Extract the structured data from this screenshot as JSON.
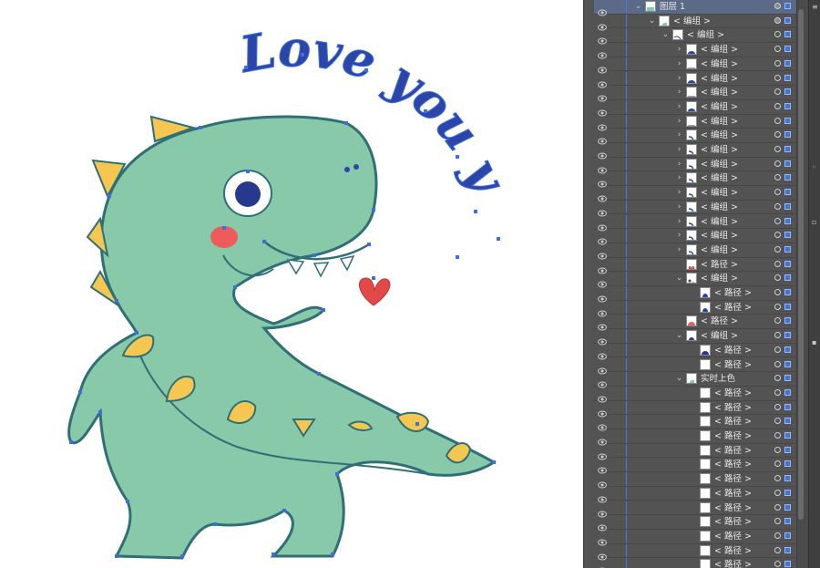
{
  "canvas": {
    "art_text": "Love you yo !!!"
  },
  "colors": {
    "dino_fill": "#88c9a9",
    "dino_stroke": "#2f6f78",
    "spike_yellow": "#f5c750",
    "text_blue": "#2b45a8",
    "cheek_red": "#ef5b5b",
    "heart_red": "#e24a4a",
    "eye_blue": "#27388f",
    "anchor_blue": "#3d6fe0",
    "panel_bg": "#535353",
    "panel_sel": "#5b6a86"
  },
  "layers_panel": {
    "rows": [
      {
        "label": "图层 1",
        "indent": 0,
        "expand": "open",
        "thumb": "layer",
        "selected": true,
        "target": "filled"
      },
      {
        "label": "< 编组 >",
        "indent": 1,
        "expand": "open",
        "thumb": "dino",
        "target": "filled"
      },
      {
        "label": "< 编组 >",
        "indent": 2,
        "expand": "open",
        "thumb": "text",
        "target": "ring"
      },
      {
        "label": "< 编组 >",
        "indent": 3,
        "expand": "closed",
        "thumb": "blob",
        "target": "ring"
      },
      {
        "label": "< 编组 >",
        "indent": 3,
        "expand": "closed",
        "thumb": "line",
        "target": "ring"
      },
      {
        "label": "< 编组 >",
        "indent": 3,
        "expand": "closed",
        "thumb": "blob",
        "target": "ring"
      },
      {
        "label": "< 编组 >",
        "indent": 3,
        "expand": "closed",
        "thumb": "line",
        "target": "ring"
      },
      {
        "label": "< 编组 >",
        "indent": 3,
        "expand": "closed",
        "thumb": "blob",
        "target": "ring"
      },
      {
        "label": "< 编组 >",
        "indent": 3,
        "expand": "closed",
        "thumb": "line",
        "target": "ring"
      },
      {
        "label": "< 编组 >",
        "indent": 3,
        "expand": "closed",
        "thumb": "glyph",
        "target": "ring"
      },
      {
        "label": "< 编组 >",
        "indent": 3,
        "expand": "closed",
        "thumb": "glyph",
        "target": "ring"
      },
      {
        "label": "< 编组 >",
        "indent": 3,
        "expand": "closed",
        "thumb": "glyph",
        "target": "ring"
      },
      {
        "label": "< 编组 >",
        "indent": 3,
        "expand": "closed",
        "thumb": "glyph",
        "target": "ring"
      },
      {
        "label": "< 编组 >",
        "indent": 3,
        "expand": "closed",
        "thumb": "glyph",
        "target": "ring"
      },
      {
        "label": "< 编组 >",
        "indent": 3,
        "expand": "closed",
        "thumb": "glyph",
        "target": "ring"
      },
      {
        "label": "< 编组 >",
        "indent": 3,
        "expand": "closed",
        "thumb": "glyph",
        "target": "ring"
      },
      {
        "label": "< 编组 >",
        "indent": 3,
        "expand": "closed",
        "thumb": "glyph",
        "target": "ring"
      },
      {
        "label": "< 编组 >",
        "indent": 3,
        "expand": "closed",
        "thumb": "glyph",
        "target": "ring"
      },
      {
        "label": "< 路径 >",
        "indent": 3,
        "expand": "none",
        "thumb": "heart",
        "target": "ring"
      },
      {
        "label": "< 编组 >",
        "indent": 3,
        "expand": "open",
        "thumb": "dots",
        "target": "ring"
      },
      {
        "label": "< 路径 >",
        "indent": 4,
        "expand": "none",
        "thumb": "oval",
        "target": "ring"
      },
      {
        "label": "< 路径 >",
        "indent": 4,
        "expand": "none",
        "thumb": "oval",
        "target": "ring"
      },
      {
        "label": "< 路径 >",
        "indent": 3,
        "expand": "none",
        "thumb": "cheek",
        "target": "ring"
      },
      {
        "label": "< 编组 >",
        "indent": 3,
        "expand": "open",
        "thumb": "eye",
        "target": "ring"
      },
      {
        "label": "< 路径 >",
        "indent": 4,
        "expand": "none",
        "thumb": "pupil",
        "target": "ring"
      },
      {
        "label": "< 路径 >",
        "indent": 4,
        "expand": "none",
        "thumb": "white",
        "target": "ring"
      },
      {
        "label": "实时上色",
        "indent": 3,
        "expand": "open",
        "thumb": "dino",
        "target": "ring"
      },
      {
        "label": "< 路径 >",
        "indent": 4,
        "expand": "none",
        "thumb": "white",
        "target": "ring"
      },
      {
        "label": "< 路径 >",
        "indent": 4,
        "expand": "none",
        "thumb": "white",
        "target": "ring"
      },
      {
        "label": "< 路径 >",
        "indent": 4,
        "expand": "none",
        "thumb": "white",
        "target": "ring"
      },
      {
        "label": "< 路径 >",
        "indent": 4,
        "expand": "none",
        "thumb": "white",
        "target": "ring"
      },
      {
        "label": "< 路径 >",
        "indent": 4,
        "expand": "none",
        "thumb": "white",
        "target": "ring"
      },
      {
        "label": "< 路径 >",
        "indent": 4,
        "expand": "none",
        "thumb": "white",
        "target": "ring"
      },
      {
        "label": "< 路径 >",
        "indent": 4,
        "expand": "none",
        "thumb": "white",
        "target": "ring"
      },
      {
        "label": "< 路径 >",
        "indent": 4,
        "expand": "none",
        "thumb": "white",
        "target": "ring"
      },
      {
        "label": "< 路径 >",
        "indent": 4,
        "expand": "none",
        "thumb": "white",
        "target": "ring"
      },
      {
        "label": "< 路径 >",
        "indent": 4,
        "expand": "none",
        "thumb": "white",
        "target": "ring"
      },
      {
        "label": "< 路径 >",
        "indent": 4,
        "expand": "none",
        "thumb": "white",
        "target": "ring"
      },
      {
        "label": "< 路径 >",
        "indent": 4,
        "expand": "none",
        "thumb": "white",
        "target": "ring"
      },
      {
        "label": "< 路径 >",
        "indent": 4,
        "expand": "none",
        "thumb": "white",
        "target": "ring"
      }
    ]
  }
}
